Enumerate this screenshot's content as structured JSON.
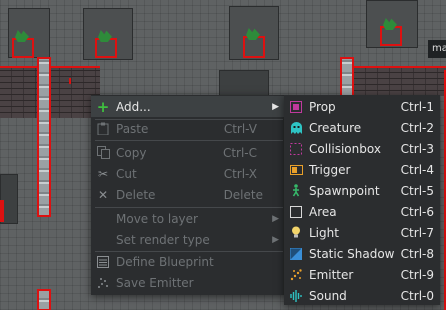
{
  "map": {
    "tooltip_text": "ma"
  },
  "context_menu": {
    "items": [
      {
        "label": "Add...",
        "icon": "plus-icon",
        "shortcut": "",
        "has_submenu": true,
        "enabled": true
      },
      {
        "label": "Paste",
        "icon": "paste-icon",
        "shortcut": "Ctrl-V",
        "has_submenu": false,
        "enabled": false
      },
      {
        "label": "Copy",
        "icon": "copy-icon",
        "shortcut": "Ctrl-C",
        "has_submenu": false,
        "enabled": false
      },
      {
        "label": "Cut",
        "icon": "scissors-icon",
        "shortcut": "Ctrl-X",
        "has_submenu": false,
        "enabled": false
      },
      {
        "label": "Delete",
        "icon": "x-icon",
        "shortcut": "Delete",
        "has_submenu": false,
        "enabled": false
      },
      {
        "label": "Move to layer",
        "icon": "",
        "shortcut": "",
        "has_submenu": true,
        "enabled": false
      },
      {
        "label": "Set render type",
        "icon": "",
        "shortcut": "",
        "has_submenu": true,
        "enabled": false
      },
      {
        "label": "Define Blueprint",
        "icon": "blueprint-icon",
        "shortcut": "",
        "has_submenu": false,
        "enabled": false
      },
      {
        "label": "Save Emitter",
        "icon": "emitter-icon",
        "shortcut": "",
        "has_submenu": false,
        "enabled": false
      }
    ]
  },
  "add_submenu": {
    "items": [
      {
        "label": "Prop",
        "icon": "prop-icon",
        "shortcut": "Ctrl-1",
        "color": "#c0399e"
      },
      {
        "label": "Creature",
        "icon": "creature-icon",
        "shortcut": "Ctrl-2",
        "color": "#2ec4c4"
      },
      {
        "label": "Collisionbox",
        "icon": "collisionbox-icon",
        "shortcut": "Ctrl-3",
        "color": "#c0399e"
      },
      {
        "label": "Trigger",
        "icon": "trigger-icon",
        "shortcut": "Ctrl-4",
        "color": "#e8a02a"
      },
      {
        "label": "Spawnpoint",
        "icon": "spawnpoint-icon",
        "shortcut": "Ctrl-5",
        "color": "#36b86a"
      },
      {
        "label": "Area",
        "icon": "area-icon",
        "shortcut": "Ctrl-6",
        "color": "#d8d8d8"
      },
      {
        "label": "Light",
        "icon": "light-icon",
        "shortcut": "Ctrl-7",
        "color": "#f2d46a"
      },
      {
        "label": "Static Shadow",
        "icon": "static-shadow-icon",
        "shortcut": "Ctrl-8",
        "color": "#3a8fd8"
      },
      {
        "label": "Emitter",
        "icon": "emitter-icon",
        "shortcut": "Ctrl-9",
        "color": "#e8a02a"
      },
      {
        "label": "Sound",
        "icon": "sound-icon",
        "shortcut": "Ctrl-0",
        "color": "#2ec4c4"
      }
    ]
  },
  "colors": {
    "menu_bg": "#2b2d2f",
    "hover_bg": "#3d4143",
    "disabled_text": "#6e7275",
    "selection_red": "#dd1111",
    "add_plus": "#3fbf3f"
  }
}
